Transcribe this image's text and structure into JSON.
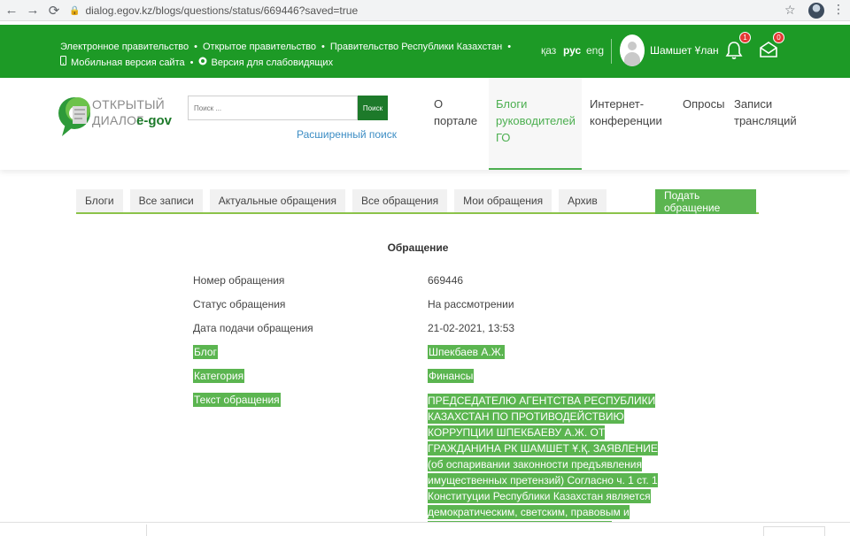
{
  "browser": {
    "back_icon": "←",
    "forward_icon": "→",
    "reload_icon": "⟳",
    "url": "dialog.egov.kz/blogs/questions/status/669446?saved=true"
  },
  "topbar": {
    "links_row1": [
      "Электронное правительство",
      "Открытое правительство",
      "Правительство Республики Казахстан"
    ],
    "links_row2": [
      "Мобильная версия сайта",
      "Версия для слабовидящих"
    ],
    "languages": [
      "қаз",
      "рус",
      "eng"
    ],
    "active_language": "рус",
    "user_name": "Шамшет Ұлан",
    "notifications_count": "1",
    "messages_count": "0",
    "accent_color": "#1d9a26"
  },
  "header": {
    "logo_line1": "ОТКРЫТЫЙ",
    "logo_line2": "ДИАЛОГ",
    "logo_brand": "e-gov",
    "search_placeholder": "Поиск ...",
    "search_button": "Поиск",
    "advanced_search": "Расширенный поиск",
    "menu": [
      {
        "label": "О портале"
      },
      {
        "label": "Блоги руководителей ГО"
      },
      {
        "label": "Интернет-конференции"
      },
      {
        "label": "Опросы"
      },
      {
        "label": "Записи трансляций"
      }
    ]
  },
  "tabs": {
    "items": [
      "Блоги",
      "Все записи",
      "Актуальные обращения",
      "Все обращения",
      "Мои обращения",
      "Архив"
    ],
    "submit": "Подать обращение"
  },
  "appeal": {
    "title": "Обращение",
    "fields": [
      {
        "label": "Номер обращения",
        "value": "669446"
      },
      {
        "label": "Статус обращения",
        "value": "На рассмотрении"
      },
      {
        "label": "Дата подачи обращения",
        "value": "21-02-2021, 13:53"
      },
      {
        "label": "Блог",
        "value": "Шпекбаев А.Ж."
      },
      {
        "label": "Категория",
        "value": "Финансы"
      },
      {
        "label": "Текст обращения",
        "value": "ПРЕДСЕДАТЕЛЮ АГЕНТСТВА РЕСПУБЛИКИ КАЗАХСТАН ПО ПРОТИВОДЕЙСТВИЮ КОРРУПЦИИ ШПЕКБАЕВУ А.Ж. ОТ ГРАЖДАНИНА РК ШАМШЕТ Ұ.Қ. ЗАЯВЛЕНИЕ (об оспаривании законности предъявления имущественных претензий) Согласно ч. 1 ст. 1 Конституции Республики Казахстан является демократическим, светским, правовым и социальным государством, высшими"
      }
    ],
    "highlight_color": "#5bb550"
  }
}
